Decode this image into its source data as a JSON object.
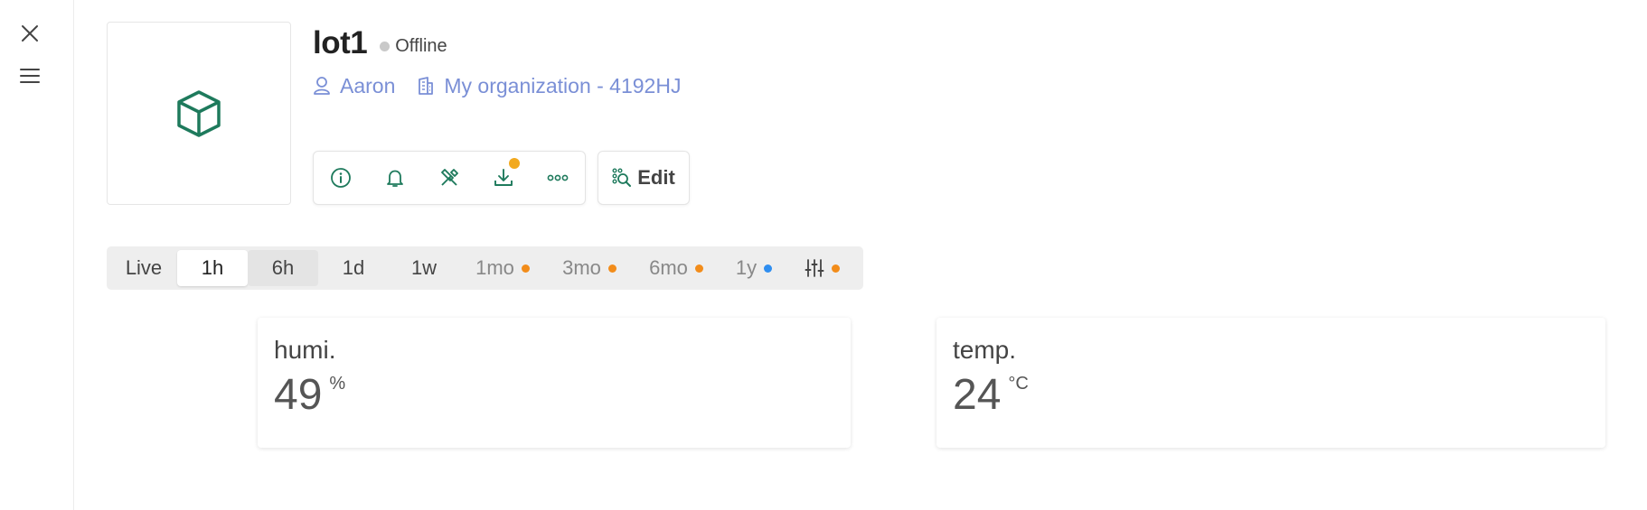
{
  "device": {
    "name": "lot1",
    "status": "Offline",
    "owner": "Aaron",
    "organization": "My organization - 4192HJ"
  },
  "toolbar": {
    "edit_label": "Edit",
    "icons": [
      "info-icon",
      "bell-icon",
      "tools-icon",
      "download-icon",
      "more-icon"
    ]
  },
  "time_ranges": [
    {
      "label": "Live"
    },
    {
      "label": "1h"
    },
    {
      "label": "6h"
    },
    {
      "label": "1d"
    },
    {
      "label": "1w"
    },
    {
      "label": "1mo"
    },
    {
      "label": "3mo"
    },
    {
      "label": "6mo"
    },
    {
      "label": "1y"
    }
  ],
  "cards": [
    {
      "label": "humi.",
      "value": "49",
      "unit": "%"
    },
    {
      "label": "temp.",
      "value": "24",
      "unit": "°C"
    }
  ],
  "colors": {
    "accent_green": "#1e7a5c",
    "link_blue": "#7a8fd6",
    "premium_dot": "#f28c1a",
    "notify_dot": "#f2a91e",
    "year_dot": "#2f8ef0",
    "offline_dot": "#c9c9c9"
  }
}
